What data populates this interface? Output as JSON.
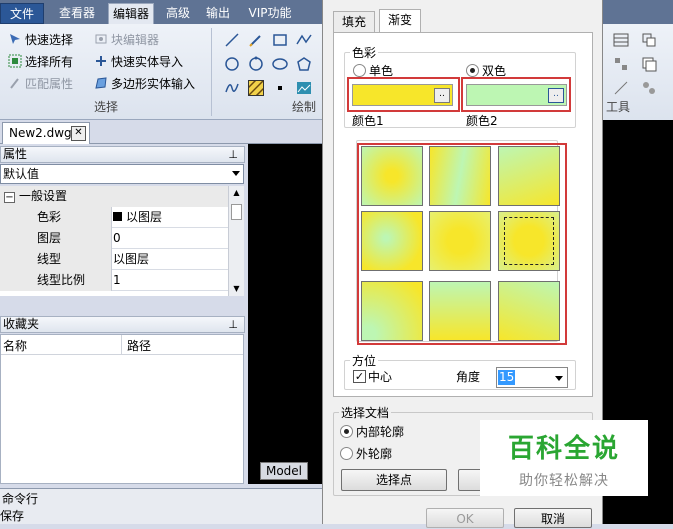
{
  "ribbon": {
    "tabs": [
      "文件",
      "查看器",
      "编辑器",
      "高级",
      "输出",
      "VIP功能"
    ],
    "active_tab": "编辑器",
    "select_group": {
      "quick_select": "快速选择",
      "block_editor": "块编辑器",
      "select_all": "选择所有",
      "quick_import": "快速实体导入",
      "match_props": "匹配属性",
      "polygon_input": "多边形实体输入",
      "label": "选择"
    },
    "draw_label": "绘制",
    "tools_label": "工具"
  },
  "document_tab": "New2.dwg",
  "properties": {
    "title": "属性",
    "combo_value": "默认值",
    "category": "一般设置",
    "rows": [
      {
        "key": "色彩",
        "value": "以图层"
      },
      {
        "key": "图层",
        "value": "0"
      },
      {
        "key": "线型",
        "value": "以图层"
      },
      {
        "key": "线型比例",
        "value": "1"
      }
    ]
  },
  "favorites": {
    "title": "收藏夹",
    "col_name": "名称",
    "col_path": "路径"
  },
  "model_tab": "Model",
  "command_line": {
    "title": "命令行",
    "text": "保存"
  },
  "dialog": {
    "tabs": [
      "填充",
      "渐变"
    ],
    "active_tab": "渐变",
    "color_group": "色彩",
    "single_color": "单色",
    "dual_color": "双色",
    "color1_label": "颜色1",
    "color2_label": "颜色2",
    "color1": "#f7e62a",
    "color2": "#bdf6b3",
    "dots": "..",
    "orientation_group": "方位",
    "center_label": "中心",
    "angle_label": "角度",
    "angle_value": "15",
    "select_doc_group": "选择文档",
    "inner_outline": "内部轮廓",
    "outer_outline": "外轮廓",
    "pick_points": "选择点",
    "ok": "OK",
    "cancel": "取消"
  },
  "watermark": {
    "title": "百科全说",
    "subtitle": "助你轻松解决"
  },
  "colors": {
    "highlight_red": "#d23a3a",
    "file_tab_blue": "#2b5797",
    "watermark_green": "#2aa632"
  }
}
